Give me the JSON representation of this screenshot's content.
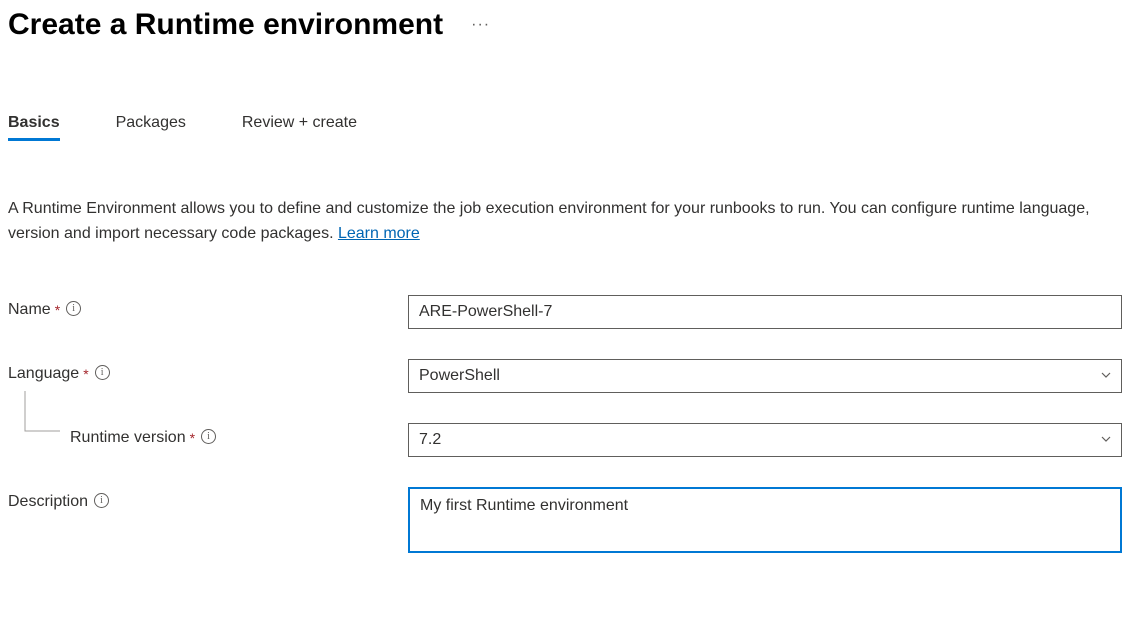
{
  "header": {
    "title": "Create a Runtime environment"
  },
  "tabs": {
    "items": [
      {
        "label": "Basics",
        "active": true
      },
      {
        "label": "Packages",
        "active": false
      },
      {
        "label": "Review + create",
        "active": false
      }
    ]
  },
  "description": {
    "text": "A Runtime Environment allows you to define and customize the job execution environment for your runbooks to run. You can configure runtime language, version and import necessary code packages. ",
    "learn_more": "Learn more"
  },
  "form": {
    "name": {
      "label": "Name",
      "value": "ARE-PowerShell-7",
      "required": true
    },
    "language": {
      "label": "Language",
      "value": "PowerShell",
      "required": true
    },
    "runtime_version": {
      "label": "Runtime version",
      "value": "7.2",
      "required": true
    },
    "description_field": {
      "label": "Description",
      "value": "My first Runtime environment",
      "required": false
    }
  }
}
